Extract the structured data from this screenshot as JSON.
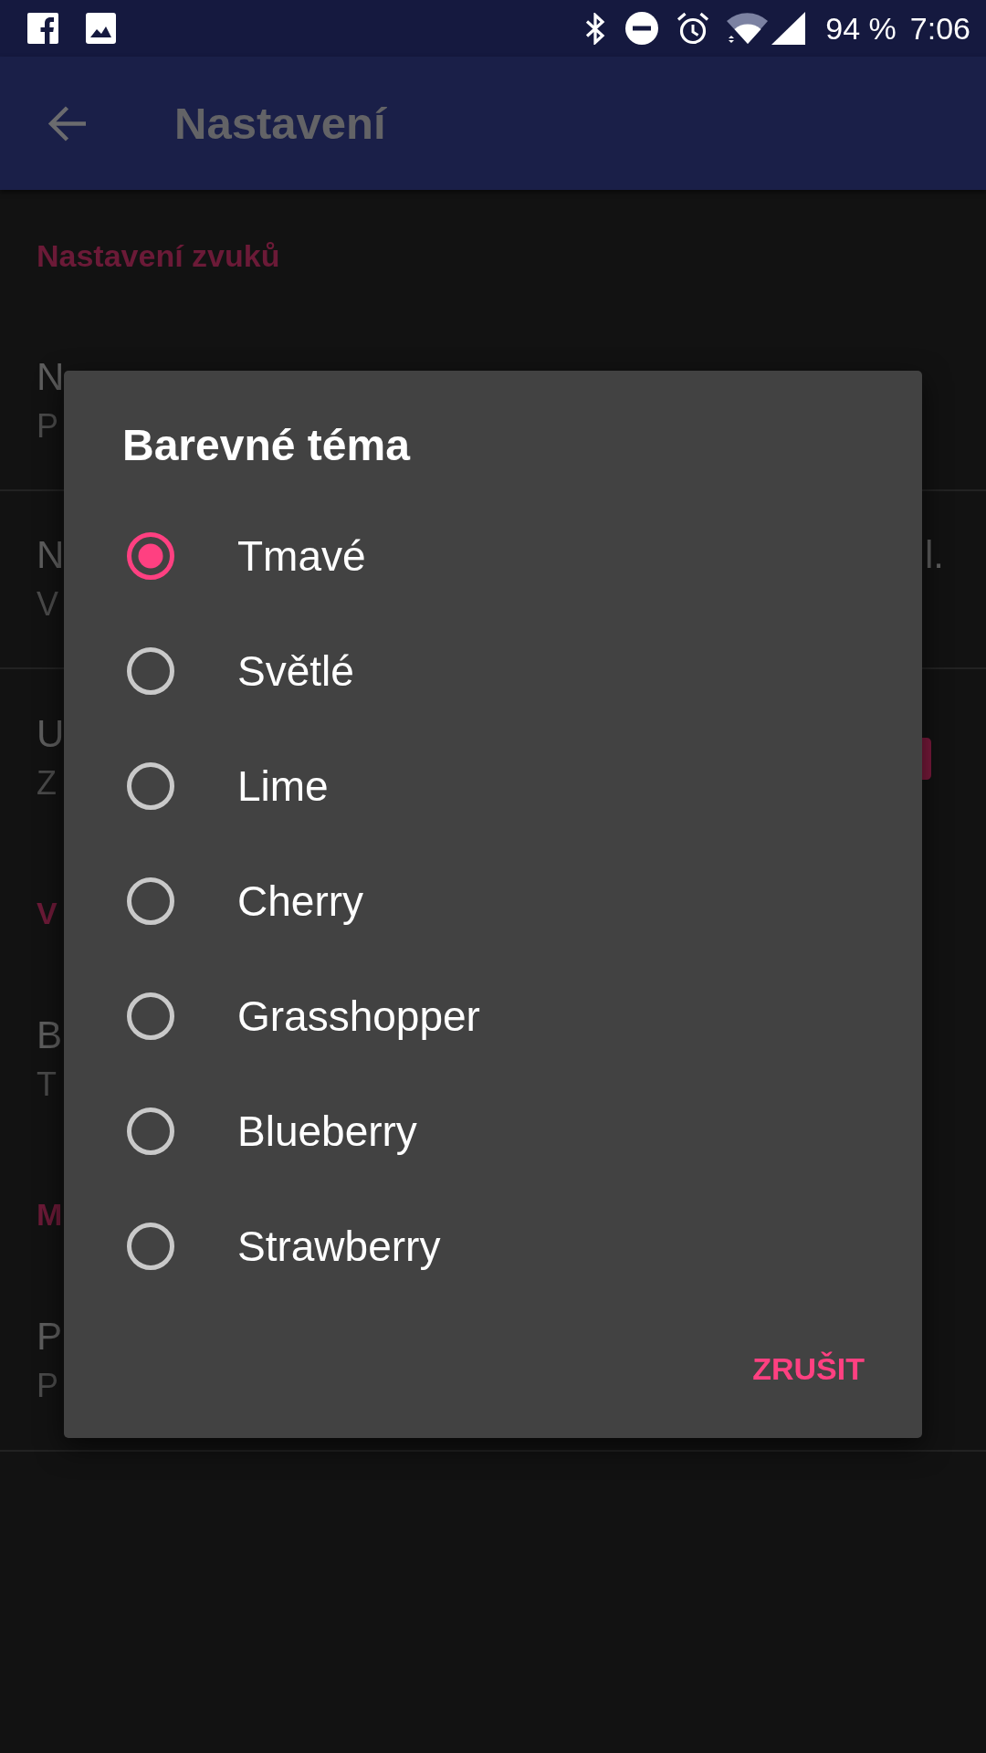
{
  "status_bar": {
    "battery": "94 %",
    "time": "7:06"
  },
  "app_bar": {
    "title": "Nastavení"
  },
  "settings": [
    {
      "header": "Nastavení zvuků",
      "items": [
        {
          "title": "N",
          "summary": "P"
        },
        {
          "title": "N",
          "title_end": "l.",
          "summary": "V"
        },
        {
          "title": "U",
          "summary": "Z",
          "checked": true
        }
      ]
    },
    {
      "header": "V",
      "items": [
        {
          "title": "B",
          "summary": "T"
        }
      ]
    },
    {
      "header": "M",
      "items": [
        {
          "title": "P",
          "summary": "P"
        }
      ]
    }
  ],
  "dialog": {
    "title": "Barevné téma",
    "options": [
      {
        "label": "Tmavé",
        "selected": true
      },
      {
        "label": "Světlé",
        "selected": false
      },
      {
        "label": "Lime",
        "selected": false
      },
      {
        "label": "Cherry",
        "selected": false
      },
      {
        "label": "Grasshopper",
        "selected": false
      },
      {
        "label": "Blueberry",
        "selected": false
      },
      {
        "label": "Strawberry",
        "selected": false
      }
    ],
    "buttons": [
      "ZRUŠIT"
    ]
  }
}
